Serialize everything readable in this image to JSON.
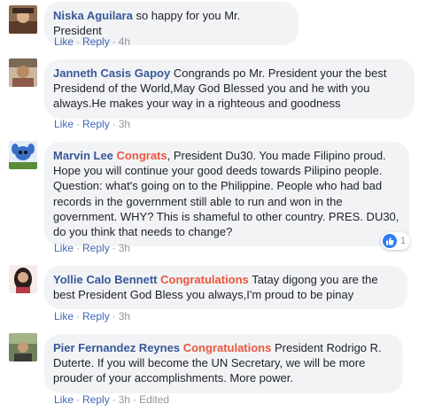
{
  "comments": [
    {
      "author": "Niska Aguilara",
      "highlight": "",
      "text": "so happy for you Mr. President",
      "actions": {
        "like": "Like",
        "reply": "Reply",
        "time": "4h",
        "edited": ""
      }
    },
    {
      "author": "Janneth Casis Gapoy",
      "highlight": "",
      "text": "Congrands po Mr. President your the best Presidend of the World,May God Blessed you and he with you always.He makes your way in a righteous and goodness",
      "actions": {
        "like": "Like",
        "reply": "Reply",
        "time": "3h",
        "edited": ""
      }
    },
    {
      "author": "Marvin Lee",
      "highlight": "Congrats",
      "text": ", President Du30. You made Filipino proud. Hope you will continue your good deeds towards Pilipino people. Question: what's going on to the Philippine. People who had bad records in the government still able to run and won in the government. WHY? This is shameful to other country. PRES. DU30, do you think that needs to change?",
      "actions": {
        "like": "Like",
        "reply": "Reply",
        "time": "3h",
        "edited": ""
      },
      "reaction": {
        "icon": "like-icon",
        "count": "1"
      }
    },
    {
      "author": "Yollie Calo Bennett",
      "highlight": "Congratulations",
      "text": "Tatay digong you are the best President God Bless you always,I'm proud to be pinay",
      "actions": {
        "like": "Like",
        "reply": "Reply",
        "time": "3h",
        "edited": ""
      }
    },
    {
      "author": "Pier Fernandez Reynes",
      "highlight": "Congratulations",
      "text": "President Rodrigo R. Duterte. If you will become the UN Secretary, we will be more prouder of your accomplishments. More power.",
      "actions": {
        "like": "Like",
        "reply": "Reply",
        "time": "3h",
        "edited": "Edited"
      }
    }
  ],
  "colors": {
    "author": "#385898",
    "highlight": "#e9573f",
    "bubble": "#f2f3f5",
    "action_link": "#4267b2",
    "meta": "#90949c"
  }
}
